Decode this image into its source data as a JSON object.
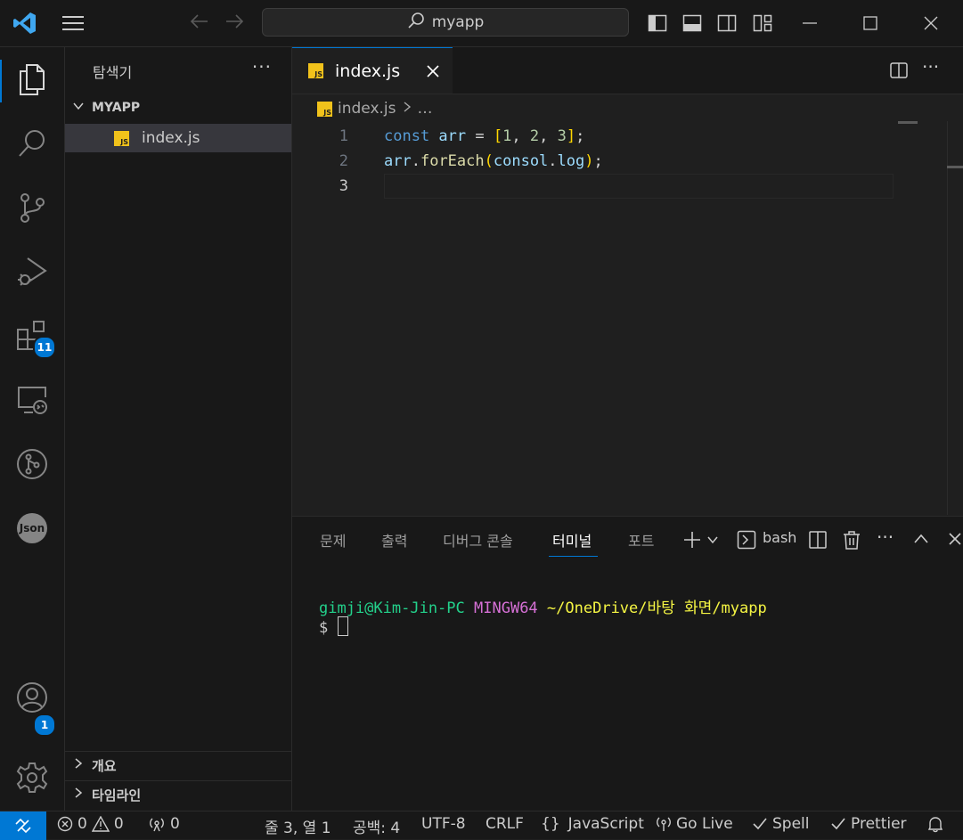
{
  "titlebar": {
    "search_text": "myapp"
  },
  "activity_bar": {
    "extensions_badge": "11",
    "accounts_badge": "1",
    "json_label": "Json"
  },
  "sidebar": {
    "title": "탐색기",
    "more": "···",
    "folder_name": "MYAPP",
    "files": [
      {
        "name": "index.js",
        "icon": "JS"
      }
    ],
    "sections": [
      {
        "label": "개요"
      },
      {
        "label": "타임라인"
      }
    ]
  },
  "editor": {
    "tab_label": "index.js",
    "breadcrumb_file": "index.js",
    "breadcrumb_more": "…",
    "lines": [
      {
        "number": "1",
        "tokens": [
          [
            "kw",
            "const "
          ],
          [
            "var",
            "arr"
          ],
          [
            "pl",
            " = "
          ],
          [
            "p1",
            "["
          ],
          [
            "num",
            "1"
          ],
          [
            "pl",
            ", "
          ],
          [
            "num",
            "2"
          ],
          [
            "pl",
            ", "
          ],
          [
            "num",
            "3"
          ],
          [
            "p1",
            "]"
          ],
          [
            "pl",
            ";"
          ]
        ]
      },
      {
        "number": "2",
        "tokens": [
          [
            "var",
            "arr"
          ],
          [
            "pl",
            "."
          ],
          [
            "fn",
            "forEach"
          ],
          [
            "p1",
            "("
          ],
          [
            "var",
            "consol"
          ],
          [
            "pl",
            "."
          ],
          [
            "var",
            "log"
          ],
          [
            "p1",
            ")"
          ],
          [
            "pl",
            ";"
          ]
        ]
      },
      {
        "number": "3",
        "tokens": []
      }
    ]
  },
  "panel": {
    "tabs": [
      "문제",
      "출력",
      "디버그 콘솔",
      "터미널",
      "포트"
    ],
    "active_tab": "터미널",
    "terminal_name": "bash",
    "prompt_user": "gimji@Kim-Jin-PC",
    "prompt_env": "MINGW64",
    "prompt_path_a": "~/OneDrive/",
    "prompt_path_b": "바탕 화면",
    "prompt_path_c": "/myapp",
    "prompt_symbol": "$"
  },
  "statusbar": {
    "errors": "0",
    "warnings": "0",
    "ports": "0",
    "position": "줄 3, 열 1",
    "spaces": "공백: 4",
    "encoding": "UTF-8",
    "eol": "CRLF",
    "language_braces": "{}",
    "language": "JavaScript",
    "golive": "Go Live",
    "spell": "Spell",
    "prettier": "Prettier"
  },
  "colors": {
    "accent": "#0078d4",
    "js_icon": "#f1c21b",
    "term_green": "#23d18b",
    "term_magenta": "#d670d6",
    "term_yellow": "#f5f543"
  }
}
